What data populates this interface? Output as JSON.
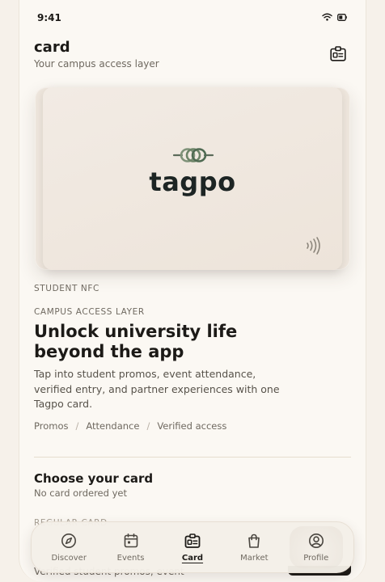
{
  "status": {
    "time": "9:41",
    "wifi_icon": "wifi-icon",
    "battery_icon": "battery-icon"
  },
  "header": {
    "title": "card",
    "subtitle": "Your campus access layer",
    "action_icon": "id-card-icon"
  },
  "card": {
    "brand": "tagpo",
    "logo_icon": "knot-logo-icon",
    "nfc_icon": "contactless-icon",
    "color": "#eee6dd"
  },
  "section": {
    "eyebrow_top": "STUDENT NFC",
    "eyebrow": "CAMPUS ACCESS LAYER",
    "headline": "Unlock university life beyond the app",
    "description": "Tap into student promos, event attendance, verified entry, and partner experiences with one Tagpo card.",
    "tags": [
      "Promos",
      "Attendance",
      "Verified access"
    ],
    "tag_separator": "/"
  },
  "choose": {
    "title": "Choose your card",
    "subtitle": "No card ordered yet",
    "peek_label": "REGULAR CARD",
    "peek_desc": "Verified student promos, event"
  },
  "tabbar": {
    "items": [
      {
        "label": "Discover",
        "icon": "compass-icon"
      },
      {
        "label": "Events",
        "icon": "calendar-icon"
      },
      {
        "label": "Card",
        "icon": "id-card-icon"
      },
      {
        "label": "Market",
        "icon": "shopping-bag-icon"
      },
      {
        "label": "Profile",
        "icon": "user-circle-icon"
      }
    ],
    "active": "Card"
  },
  "colors": {
    "background": "#fbf8f3",
    "text": "#1c1a17",
    "muted": "#6f6960",
    "brand_dark": "#1d2524"
  }
}
